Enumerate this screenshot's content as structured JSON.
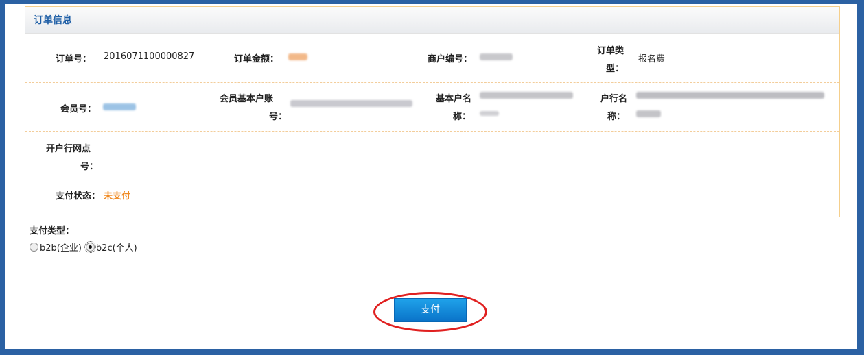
{
  "panel": {
    "title": "订单信息"
  },
  "order": {
    "order_no_label": "订单号：",
    "order_no": "2016071100000827",
    "amount_label": "订单金额：",
    "merchant_label": "商户编号：",
    "type_label_1": "订单类",
    "type_label_2": "型：",
    "type_value": "报名费",
    "member_label": "会员号：",
    "account_label_1": "会员基本户账",
    "account_label_2": "号：",
    "basic_name_label_1": "基本户名",
    "basic_name_label_2": "称：",
    "bank_name_label_1": "户行名",
    "bank_name_label_2": "称：",
    "branch_label_1": "开户行网点",
    "branch_label_2": "号：",
    "status_label": "支付状态：",
    "status_value": "未支付"
  },
  "payment": {
    "type_label": "支付类型：",
    "option_b2b": "b2b(企业)",
    "option_b2c": "b2c(个人)",
    "selected": "b2c",
    "pay_button": "支付"
  },
  "colors": {
    "accent": "#1f5fa6",
    "status": "#f08a22",
    "highlight": "#e02020",
    "button": "#0a73c9"
  }
}
